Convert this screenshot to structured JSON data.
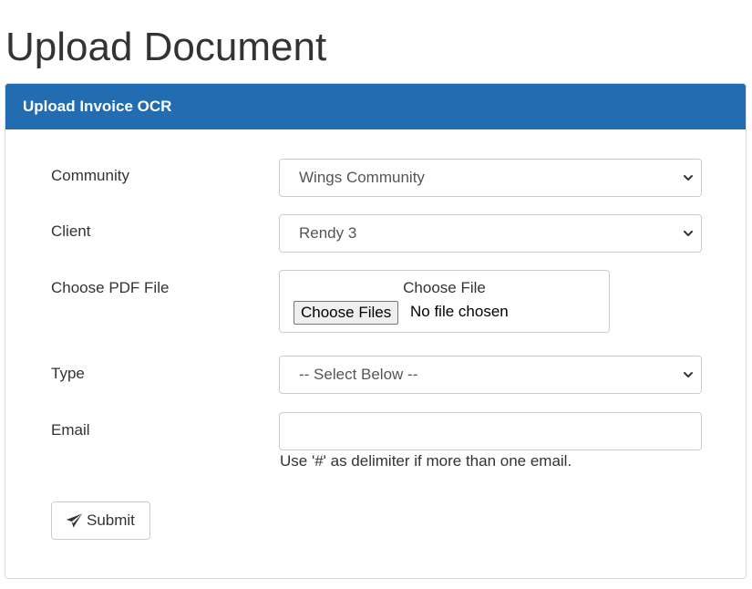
{
  "page": {
    "title": "Upload Document"
  },
  "panel": {
    "heading": "Upload Invoice OCR",
    "heading_color": "#226db1"
  },
  "form": {
    "community": {
      "label": "Community",
      "selected": "Wings Community"
    },
    "client": {
      "label": "Client",
      "selected": "Rendy 3"
    },
    "pdf_file": {
      "label": "Choose PDF File",
      "caption": "Choose File",
      "button_label": "Choose Files",
      "status": "No file chosen"
    },
    "type": {
      "label": "Type",
      "selected": "-- Select Below --"
    },
    "email": {
      "label": "Email",
      "value": "",
      "help": "Use '#' as delimiter if more than one email."
    },
    "submit": {
      "label": "Submit",
      "icon": "paper-plane-icon"
    }
  },
  "icons": {
    "select_arrow": "chevron-down-icon"
  }
}
